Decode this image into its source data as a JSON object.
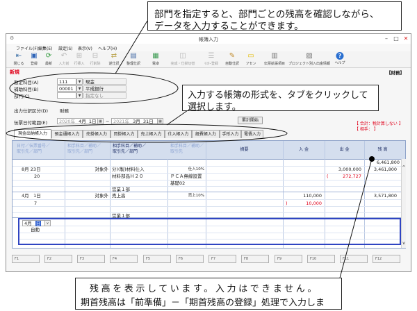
{
  "window": {
    "title": "帳簿入力",
    "controls": {
      "minimize": "–",
      "maximize": "□",
      "close": "✕"
    }
  },
  "menu": [
    "ファイル(F)",
    "編集(E)",
    "設定(S)",
    "表示(V)",
    "ヘルプ(H)"
  ],
  "toolbar": [
    {
      "label": "閉じる",
      "icon": "close-door-icon",
      "glyph": "⇤"
    },
    {
      "label": "登録",
      "icon": "register-icon",
      "glyph": "▣"
    },
    {
      "label": "最新",
      "icon": "refresh-icon",
      "glyph": "⟳"
    },
    {
      "label": "入力前",
      "icon": "undo-icon",
      "glyph": "↶"
    },
    {
      "label": "行挿入",
      "icon": "row-insert-icon",
      "glyph": "⊞"
    },
    {
      "label": "行削除",
      "icon": "row-delete-icon",
      "glyph": "⊟"
    },
    {
      "label": "逆仕訳",
      "icon": "reverse-entry-icon",
      "glyph": "⇄"
    },
    {
      "label": "整理仕訳",
      "icon": "adjust-entry-icon",
      "glyph": "▤"
    },
    {
      "label": "電卓",
      "icon": "calculator-icon",
      "glyph": "▦"
    },
    {
      "label": "完成・仕掛切替",
      "icon": "switch-icon",
      "glyph": "◫"
    },
    {
      "label": "ﾏｽﾀｰ登録",
      "icon": "master-register-icon",
      "glyph": "☰"
    },
    {
      "label": "自動仕訳",
      "icon": "auto-entry-icon",
      "glyph": "✎"
    },
    {
      "label": "フセン",
      "icon": "sticky-note-icon",
      "glyph": "▭"
    },
    {
      "label": "伝票拡張項目",
      "icon": "slip-extension-icon",
      "glyph": "▥"
    },
    {
      "label": "プロジェクト別入出金情報",
      "icon": "project-info-icon",
      "glyph": "▨"
    },
    {
      "label": "ヘルプ",
      "icon": "help-icon",
      "glyph": "?"
    }
  ],
  "status": {
    "mode": "新規",
    "section": "【財務】"
  },
  "fields": {
    "account": {
      "label": "勘定科目(A)",
      "code": "111",
      "name": "現金"
    },
    "sub_account": {
      "label": "補助科目(B)",
      "code": "00001",
      "name": "平成銀行"
    },
    "department": {
      "label": "部門(C)",
      "code": "",
      "name": "指定なし"
    },
    "output_class": {
      "label": "出力仕訳区分(D)",
      "value": "財務"
    },
    "date_range": {
      "label": "伝票日付範囲(E)",
      "from_year": "2020年",
      "from_month": "4月",
      "from_day": "1日",
      "separator": "~",
      "to_year": "2021年",
      "to_month": "3月",
      "to_day": "31日"
    },
    "cumulative_button": "累計開始",
    "summary": {
      "total": "【 合計：税計算しない 】",
      "partner": "【 相手： 】"
    }
  },
  "tabs": [
    "現金出納帳入力",
    "預金通帳入力",
    "売掛帳入力",
    "買掛帳入力",
    "売上帳入力",
    "仕入帳入力",
    "経費帳入力",
    "手形入力",
    "電債入力"
  ],
  "active_tab": "現金出納帳入力",
  "grid": {
    "headers": {
      "date": [
        "日付／伝票番号／",
        "取引先／部門"
      ],
      "tax_col": [
        "相手科目／補助／",
        "取引先／部門"
      ],
      "counter_account": [
        "相手科目／補助／",
        "取引先／部門"
      ],
      "counter_sub": [
        "相手科目／補助／",
        "取引先"
      ],
      "memo": "摘要",
      "deposit": "入 金",
      "withdrawal": "出 金",
      "balance": "残 高"
    },
    "opening_balance": "6,461,800",
    "entries": [
      {
        "date": "8月 23日",
        "slip_no": "20",
        "tax_class": "対象外",
        "account": "分)(製)材料仕入",
        "tax": "仕入10%",
        "sub_account": "材料部品Ｈ２０",
        "partner": "ＰＣＡ無線設置",
        "dept_code": "基礎02",
        "department": "営業１部",
        "deposit": "",
        "withdrawal": "3,000,000",
        "tax_mark": "(",
        "tax_amount": "272,727",
        "balance": "3,461,800"
      },
      {
        "date": "4月　1日",
        "slip_no": "7",
        "tax_class": "対象外",
        "account": "売上高",
        "tax": "売上10%",
        "department": "営業１部",
        "deposit": "110,000",
        "withdrawal": "",
        "tax_mark": ")",
        "tax_amount": "10,000",
        "balance": "3,571,800"
      }
    ]
  },
  "input_row": {
    "month": "4月",
    "day": "日",
    "mode": "自動"
  },
  "scroll": {
    "up": "^",
    "down": "v"
  },
  "function_keys": [
    "F1",
    "F2",
    "F3",
    "F4",
    "F5",
    "F6",
    "F7",
    "F8",
    "F9",
    "F10",
    "F11",
    "F12"
  ],
  "callouts": {
    "department": {
      "line1": "部門を指定すると、部門ごとの残高を確認しながら、",
      "line2": "データを入力することができます。"
    },
    "tabs": {
      "line1": "入力する帳簿の形式を、タブをクリックして",
      "line2": "選択します。"
    },
    "balance": {
      "line1": "残高を表示しています。入力はできません。",
      "line2": "期首残高は「前準備」－「期首残高の登録」処理で入力しま"
    }
  },
  "colors": {
    "accent_red": "#e0001a",
    "input_border": "#2f44c2",
    "grid_header": "#d4deee"
  }
}
